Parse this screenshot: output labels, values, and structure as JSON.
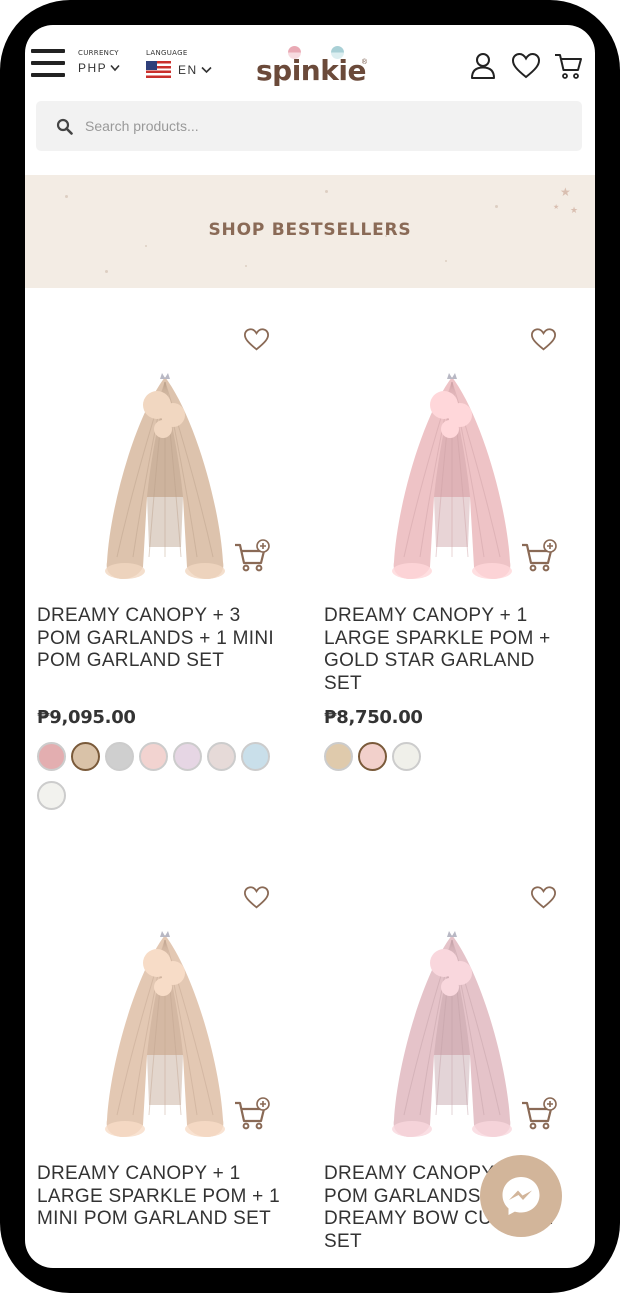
{
  "header": {
    "currency_label": "CURRENCY",
    "currency_value": "PHP",
    "language_label": "LANGUAGE",
    "language_value": "EN",
    "logo": "spinkie"
  },
  "search": {
    "placeholder": "Search products..."
  },
  "banner": {
    "title": "SHOP BESTSELLERS"
  },
  "products": [
    {
      "name": "DREAMY CANOPY + 3 POM GARLANDS + 1 MINI POM GARLAND SET",
      "price": "₱9,095.00",
      "canopy_color": "#ddc3ad",
      "swatches": [
        "#e3aeb0",
        "#d9c2a8",
        "#cfcfcf",
        "#f2d3d0",
        "#e6d6e4",
        "#e6dad8",
        "#c9dfea",
        "#f2f2ee"
      ],
      "selected_swatch": 1
    },
    {
      "name": "DREAMY CANOPY + 1 LARGE SPARKLE POM + GOLD STAR GARLAND SET",
      "price": "₱8,750.00",
      "canopy_color": "#eec3c6",
      "swatches": [
        "#dfcaac",
        "#f2d0cb",
        "#f0f0ea"
      ],
      "selected_swatch": 1
    },
    {
      "name": "DREAMY CANOPY + 1 LARGE SPARKLE POM + 1 MINI POM GARLAND SET",
      "price": "",
      "canopy_color": "#e3c8b3",
      "swatches": [],
      "selected_swatch": -1
    },
    {
      "name": "DREAMY CANOPY + 2 POM GARLANDS + DREAMY BOW CUSHION SET",
      "price": "",
      "canopy_color": "#e5c3c9",
      "swatches": [],
      "selected_swatch": -1
    }
  ],
  "icons": {
    "menu": "hamburger-icon",
    "account": "user-icon",
    "wishlist": "heart-icon",
    "cart": "cart-icon",
    "chat": "messenger-icon"
  },
  "colors": {
    "brand": "#6b4a3a",
    "accent": "#8a6a56",
    "banner_bg": "#f3ece4",
    "chat_bubble": "#d2b59a"
  }
}
